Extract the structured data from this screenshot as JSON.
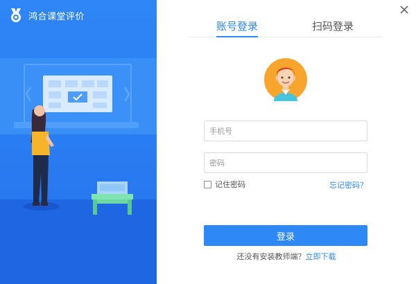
{
  "app": {
    "title": "鸿合课堂评价",
    "logo_icon": "medal-logo-icon"
  },
  "window": {
    "close_icon": "close-icon"
  },
  "tabs": [
    {
      "label": "账号登录",
      "active": true
    },
    {
      "label": "扫码登录",
      "active": false
    }
  ],
  "avatar": {
    "icon": "teacher-avatar-icon"
  },
  "form": {
    "phone_placeholder": "手机号",
    "phone_value": "",
    "password_placeholder": "密码",
    "password_value": "",
    "remember_label": "记住密码",
    "remember_checked": false,
    "forgot_label": "忘记密码？",
    "login_label": "登录"
  },
  "footer": {
    "prompt": "还没有安装教师端？",
    "download_link": "立即下载"
  },
  "colors": {
    "accent": "#2e88f5",
    "left_panel": "#2a7bf1",
    "input_border": "#d9d9d9"
  }
}
